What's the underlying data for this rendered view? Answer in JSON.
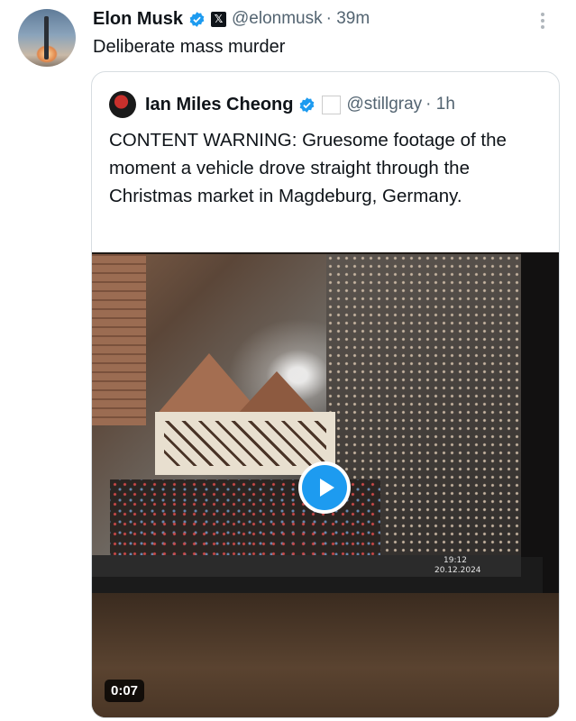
{
  "post": {
    "author_name": "Elon Musk",
    "author_handle": "@elonmusk",
    "time": "· 39m",
    "text": "Deliberate mass murder",
    "verified_icon": "verified-badge-icon",
    "affiliation_icon": "x-logo-icon",
    "more_icon": "more-vertical-icon"
  },
  "quote": {
    "author_name": "Ian Miles Cheong",
    "author_handle": "@stillgray",
    "time": "· 1h",
    "badge_icon": "news-badge-icon",
    "text": "CONTENT WARNING: Gruesome footage of the moment a vehicle drove straight through the Christmas market in Magdeburg, Germany.",
    "video": {
      "duration": "0:07",
      "play_icon": "play-icon",
      "screen_clock": "19:12",
      "screen_date": "20.12.2024"
    }
  },
  "colors": {
    "accent": "#1d9bf0",
    "text": "#0f1419",
    "secondary": "#536471",
    "border": "#d7dde1"
  }
}
